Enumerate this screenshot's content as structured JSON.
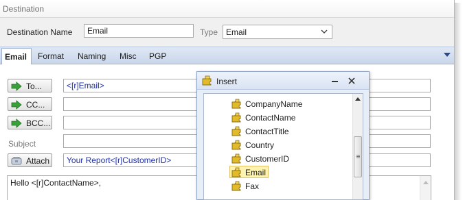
{
  "window": {
    "title": "Destination"
  },
  "header": {
    "name_label": "Destination Name",
    "name_value": "Email",
    "type_label": "Type",
    "type_value": "Email"
  },
  "tabs": [
    {
      "label": "Email",
      "active": true
    },
    {
      "label": "Format"
    },
    {
      "label": "Naming"
    },
    {
      "label": "Misc"
    },
    {
      "label": "PGP"
    }
  ],
  "email": {
    "to_label": "To...",
    "to_value": "<[r]Email>",
    "cc_label": "CC...",
    "cc_value": "",
    "bcc_label": "BCC...",
    "bcc_value": "",
    "subject_label": "Subject",
    "subject_value": "",
    "attach_label": "Attach",
    "attach_value": "Your Report<[r]CustomerID>",
    "body_value": "Hello <[r]ContactName>,"
  },
  "insert_popup": {
    "title": "Insert",
    "items": [
      "CompanyName",
      "ContactName",
      "ContactTitle",
      "Country",
      "CustomerID",
      "Email",
      "Fax"
    ],
    "selected": "Email",
    "scroll_position": 0.45
  },
  "colors": {
    "tab_strip": "#c9d6ea",
    "selection": "#fff3b0",
    "field_text_blue": "#1f2fa8",
    "arrow_green": "#3aa03a"
  }
}
